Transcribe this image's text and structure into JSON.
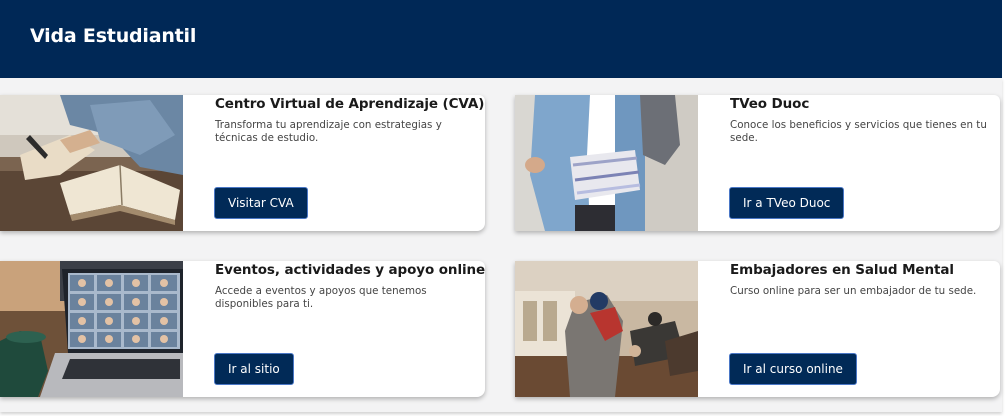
{
  "header": {
    "title": "Vida Estudiantil"
  },
  "cards": [
    {
      "title": "Centro Virtual de Aprendizaje (CVA)",
      "description": "Transforma tu aprendizaje con estrategias y técnicas de estudio.",
      "button_label": "Visitar CVA"
    },
    {
      "title": "TVeo Duoc",
      "description": "Conoce los beneficios y servicios que tienes en tu sede.",
      "button_label": "Ir a TVeo Duoc"
    },
    {
      "title": "Eventos, actividades y apoyo online",
      "description": "Accede a eventos y apoyos que tenemos disponibles para ti.",
      "button_label": "Ir al sitio"
    },
    {
      "title": "Embajadores en Salud Mental",
      "description": "Curso online para ser un embajador de tu sede.",
      "button_label": "Ir al curso online"
    }
  ],
  "colors": {
    "header_bg": "#002856",
    "button_bg": "#012a57",
    "button_border": "#4a77c6",
    "panel_bg": "#f3f3f4"
  }
}
